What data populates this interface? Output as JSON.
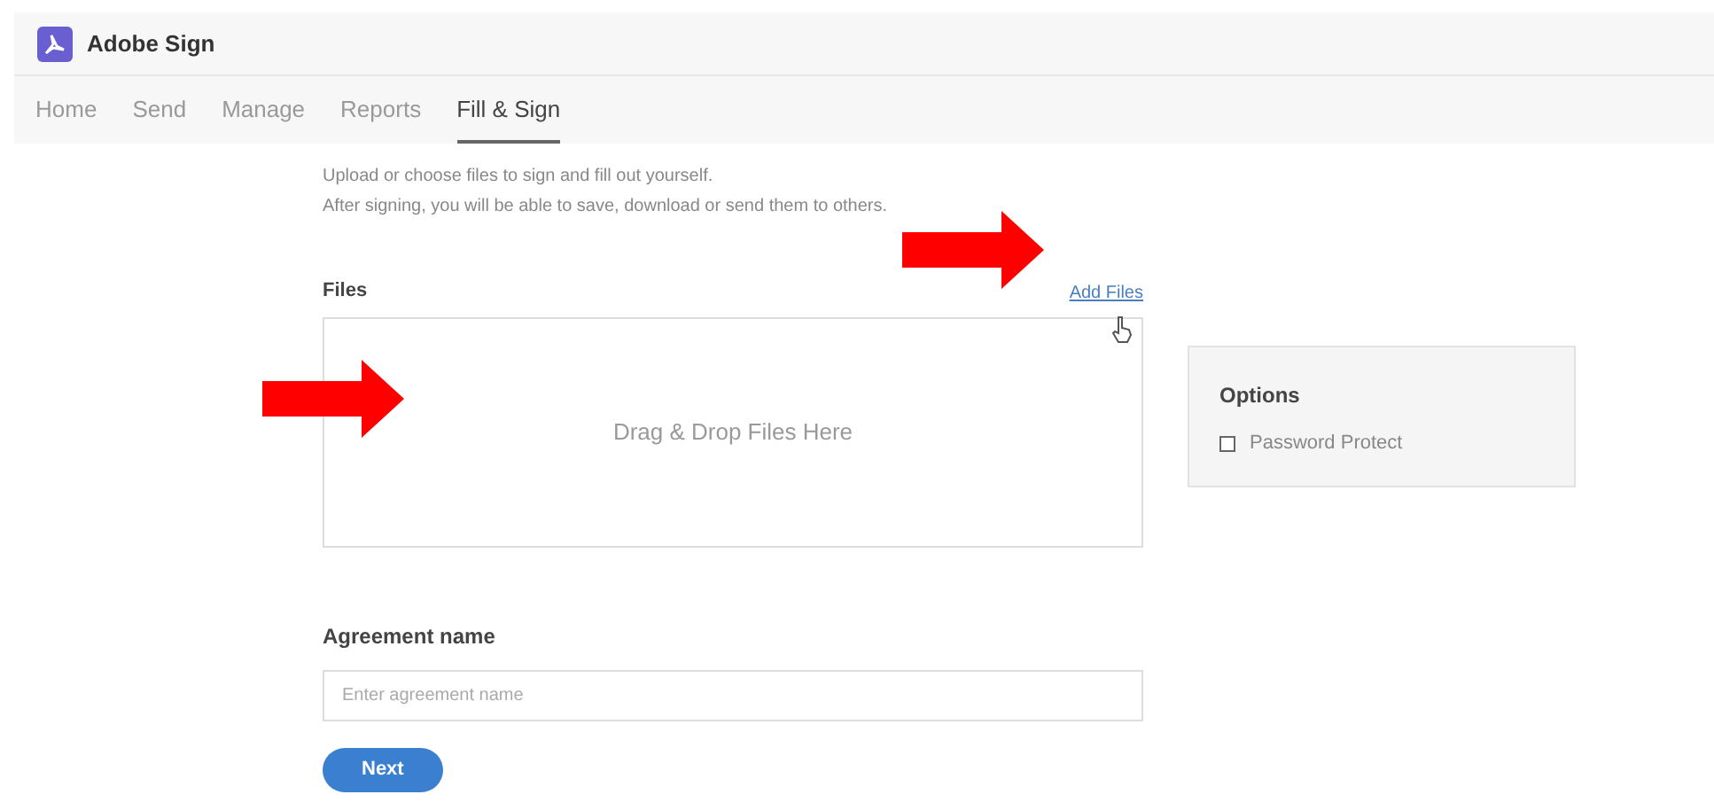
{
  "app": {
    "title": "Adobe Sign"
  },
  "tabs": [
    {
      "label": "Home",
      "selected": false
    },
    {
      "label": "Send",
      "selected": false
    },
    {
      "label": "Manage",
      "selected": false
    },
    {
      "label": "Reports",
      "selected": false
    },
    {
      "label": "Fill & Sign",
      "selected": true
    }
  ],
  "intro": [
    "Upload or choose files to sign and fill out yourself.",
    "After signing, you will be able to save, download or send them to others."
  ],
  "files": {
    "heading": "Files",
    "add_link": "Add Files",
    "drop_zone": "Drag & Drop Files Here"
  },
  "options": {
    "heading": "Options",
    "items": [
      {
        "label": "Password Protect",
        "checked": false
      }
    ]
  },
  "agreement": {
    "label": "Agreement name",
    "placeholder": "Enter agreement name"
  },
  "buttons": [
    "Next"
  ]
}
